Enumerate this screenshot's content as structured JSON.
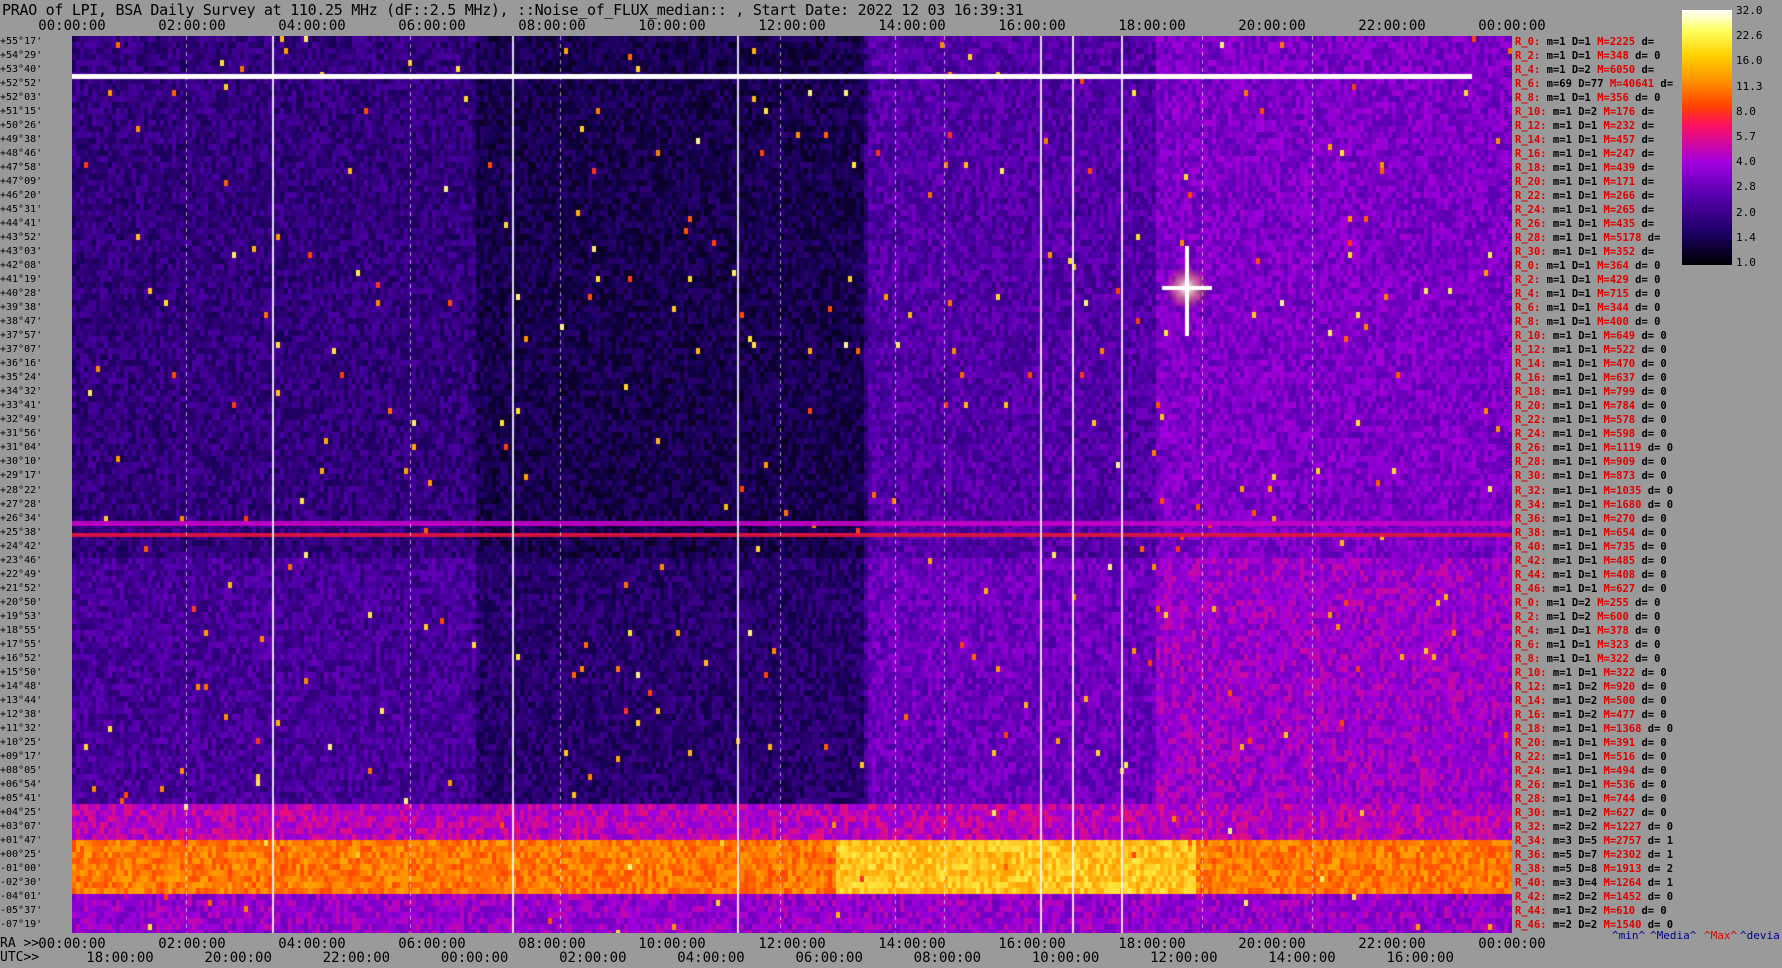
{
  "title": "PRAO of LPI, BSA Daily Survey at 110.25 MHz (dF::2.5 MHz), ::Noise_of_FLUX_median:: , Start Date: 2022 12 03 16:39:31",
  "colors": {
    "background": "#9a9a9a",
    "stat_label": "#e00000",
    "legend_max": "#e00000",
    "legend_other": "#00008b"
  },
  "chart_data": {
    "type": "heatmap",
    "title": "PRAO of LPI, BSA Daily Survey at 110.25 MHz (dF::2.5 MHz), ::Noise_of_FLUX_median:: , Start Date: 2022 12 03 16:39:31",
    "x_top_ticks": [
      "00:00:00",
      "02:00:00",
      "04:00:00",
      "06:00:00",
      "08:00:00",
      "10:00:00",
      "12:00:00",
      "14:00:00",
      "16:00:00",
      "18:00:00",
      "20:00:00",
      "22:00:00",
      "00:00:00"
    ],
    "x_bottom_ra_prefix": "RA >>",
    "x_bottom_ra_ticks": [
      "00:00:00",
      "02:00:00",
      "04:00:00",
      "06:00:00",
      "08:00:00",
      "10:00:00",
      "12:00:00",
      "14:00:00",
      "16:00:00",
      "18:00:00",
      "20:00:00",
      "22:00:00",
      "00:00:00"
    ],
    "x_bottom_utc_prefix": "UTC>>",
    "x_bottom_utc_ticks": [
      "18:00:00",
      "20:00:00",
      "22:00:00",
      "00:00:00",
      "02:00:00",
      "04:00:00",
      "06:00:00",
      "08:00:00",
      "10:00:00",
      "12:00:00",
      "14:00:00",
      "16:00:00"
    ],
    "colorbar_ticks": [
      "32.0",
      "22.6",
      "16.0",
      "11.3",
      "8.0",
      "5.7",
      "4.0",
      "2.8",
      "2.0",
      "1.4",
      "1.0"
    ],
    "declinations": [
      "+55°17'",
      "+54°29'",
      "+53°40'",
      "+52°52'",
      "+52°03'",
      "+51°15'",
      "+50°26'",
      "+49°38'",
      "+48°46'",
      "+47°58'",
      "+47°09'",
      "+46°20'",
      "+45°31'",
      "+44°41'",
      "+43°52'",
      "+43°03'",
      "+42°08'",
      "+41°19'",
      "+40°28'",
      "+39°38'",
      "+38°47'",
      "+37°57'",
      "+37°07'",
      "+36°16'",
      "+35°24'",
      "+34°32'",
      "+33°41'",
      "+32°49'",
      "+31°56'",
      "+31°04'",
      "+30°10'",
      "+29°17'",
      "+28°22'",
      "+27°28'",
      "+26°34'",
      "+25°38'",
      "+24°42'",
      "+23°46'",
      "+22°49'",
      "+21°52'",
      "+20°50'",
      "+19°53'",
      "+18°55'",
      "+17°55'",
      "+16°52'",
      "+15°50'",
      "+14°48'",
      "+13°44'",
      "+12°38'",
      "+11°32'",
      "+10°25'",
      "+09°17'",
      "+08°05'",
      "+06°54'",
      "+05°41'",
      "+04°25'",
      "+03°07'",
      "+01°47'",
      "+00°25'",
      "-01°00'",
      "-02°30'",
      "-04°01'",
      "-05°37'",
      "-07°19'"
    ],
    "stats": [
      {
        "id": "R_0:",
        "m": "1",
        "d": "1",
        "M": "2225",
        "dev": ""
      },
      {
        "id": "R_2:",
        "m": "1",
        "d": "1",
        "M": "348",
        "dev": "0"
      },
      {
        "id": "R_4:",
        "m": "1",
        "d": "2",
        "M": "6050",
        "dev": ""
      },
      {
        "id": "R_6:",
        "m": "69",
        "d": "77",
        "M": "40641",
        "dev": ""
      },
      {
        "id": "R_8:",
        "m": "1",
        "d": "1",
        "M": "356",
        "dev": "0"
      },
      {
        "id": "R_10:",
        "m": "1",
        "d": "2",
        "M": "176",
        "dev": ""
      },
      {
        "id": "R_12:",
        "m": "1",
        "d": "1",
        "M": "232",
        "dev": ""
      },
      {
        "id": "R_14:",
        "m": "1",
        "d": "1",
        "M": "457",
        "dev": ""
      },
      {
        "id": "R_16:",
        "m": "1",
        "d": "1",
        "M": "247",
        "dev": ""
      },
      {
        "id": "R_18:",
        "m": "1",
        "d": "1",
        "M": "439",
        "dev": ""
      },
      {
        "id": "R_20:",
        "m": "1",
        "d": "1",
        "M": "171",
        "dev": ""
      },
      {
        "id": "R_22:",
        "m": "1",
        "d": "1",
        "M": "266",
        "dev": ""
      },
      {
        "id": "R_24:",
        "m": "1",
        "d": "1",
        "M": "265",
        "dev": ""
      },
      {
        "id": "R_26:",
        "m": "1",
        "d": "1",
        "M": "435",
        "dev": ""
      },
      {
        "id": "R_28:",
        "m": "1",
        "d": "1",
        "M": "5178",
        "dev": ""
      },
      {
        "id": "R_30:",
        "m": "1",
        "d": "1",
        "M": "352",
        "dev": ""
      },
      {
        "id": "R_0:",
        "m": "1",
        "d": "1",
        "M": "364",
        "dev": "0"
      },
      {
        "id": "R_2:",
        "m": "1",
        "d": "1",
        "M": "429",
        "dev": "0"
      },
      {
        "id": "R_4:",
        "m": "1",
        "d": "1",
        "M": "715",
        "dev": "0"
      },
      {
        "id": "R_6:",
        "m": "1",
        "d": "1",
        "M": "344",
        "dev": "0"
      },
      {
        "id": "R_8:",
        "m": "1",
        "d": "1",
        "M": "400",
        "dev": "0"
      },
      {
        "id": "R_10:",
        "m": "1",
        "d": "1",
        "M": "649",
        "dev": "0"
      },
      {
        "id": "R_12:",
        "m": "1",
        "d": "1",
        "M": "522",
        "dev": "0"
      },
      {
        "id": "R_14:",
        "m": "1",
        "d": "1",
        "M": "470",
        "dev": "0"
      },
      {
        "id": "R_16:",
        "m": "1",
        "d": "1",
        "M": "637",
        "dev": "0"
      },
      {
        "id": "R_18:",
        "m": "1",
        "d": "1",
        "M": "799",
        "dev": "0"
      },
      {
        "id": "R_20:",
        "m": "1",
        "d": "1",
        "M": "784",
        "dev": "0"
      },
      {
        "id": "R_22:",
        "m": "1",
        "d": "1",
        "M": "578",
        "dev": "0"
      },
      {
        "id": "R_24:",
        "m": "1",
        "d": "1",
        "M": "598",
        "dev": "0"
      },
      {
        "id": "R_26:",
        "m": "1",
        "d": "1",
        "M": "1119",
        "dev": "0"
      },
      {
        "id": "R_28:",
        "m": "1",
        "d": "1",
        "M": "909",
        "dev": "0"
      },
      {
        "id": "R_30:",
        "m": "1",
        "d": "1",
        "M": "873",
        "dev": "0"
      },
      {
        "id": "R_32:",
        "m": "1",
        "d": "1",
        "M": "1035",
        "dev": "0"
      },
      {
        "id": "R_34:",
        "m": "1",
        "d": "1",
        "M": "1680",
        "dev": "0"
      },
      {
        "id": "R_36:",
        "m": "1",
        "d": "1",
        "M": "270",
        "dev": "0"
      },
      {
        "id": "R_38:",
        "m": "1",
        "d": "1",
        "M": "654",
        "dev": "0"
      },
      {
        "id": "R_40:",
        "m": "1",
        "d": "1",
        "M": "735",
        "dev": "0"
      },
      {
        "id": "R_42:",
        "m": "1",
        "d": "1",
        "M": "485",
        "dev": "0"
      },
      {
        "id": "R_44:",
        "m": "1",
        "d": "1",
        "M": "408",
        "dev": "0"
      },
      {
        "id": "R_46:",
        "m": "1",
        "d": "1",
        "M": "627",
        "dev": "0"
      },
      {
        "id": "R_0:",
        "m": "1",
        "d": "2",
        "M": "255",
        "dev": "0"
      },
      {
        "id": "R_2:",
        "m": "1",
        "d": "2",
        "M": "600",
        "dev": "0"
      },
      {
        "id": "R_4:",
        "m": "1",
        "d": "1",
        "M": "378",
        "dev": "0"
      },
      {
        "id": "R_6:",
        "m": "1",
        "d": "1",
        "M": "323",
        "dev": "0"
      },
      {
        "id": "R_8:",
        "m": "1",
        "d": "1",
        "M": "322",
        "dev": "0"
      },
      {
        "id": "R_10:",
        "m": "1",
        "d": "1",
        "M": "322",
        "dev": "0"
      },
      {
        "id": "R_12:",
        "m": "1",
        "d": "2",
        "M": "920",
        "dev": "0"
      },
      {
        "id": "R_14:",
        "m": "1",
        "d": "2",
        "M": "500",
        "dev": "0"
      },
      {
        "id": "R_16:",
        "m": "1",
        "d": "2",
        "M": "477",
        "dev": "0"
      },
      {
        "id": "R_18:",
        "m": "1",
        "d": "1",
        "M": "1368",
        "dev": "0"
      },
      {
        "id": "R_20:",
        "m": "1",
        "d": "1",
        "M": "391",
        "dev": "0"
      },
      {
        "id": "R_22:",
        "m": "1",
        "d": "1",
        "M": "516",
        "dev": "0"
      },
      {
        "id": "R_24:",
        "m": "1",
        "d": "1",
        "M": "494",
        "dev": "0"
      },
      {
        "id": "R_26:",
        "m": "1",
        "d": "1",
        "M": "536",
        "dev": "0"
      },
      {
        "id": "R_28:",
        "m": "1",
        "d": "1",
        "M": "744",
        "dev": "0"
      },
      {
        "id": "R_30:",
        "m": "1",
        "d": "2",
        "M": "627",
        "dev": "0"
      },
      {
        "id": "R_32:",
        "m": "2",
        "d": "2",
        "M": "1227",
        "dev": "0"
      },
      {
        "id": "R_34:",
        "m": "3",
        "d": "5",
        "M": "2757",
        "dev": "1"
      },
      {
        "id": "R_36:",
        "m": "5",
        "d": "7",
        "M": "2302",
        "dev": "1"
      },
      {
        "id": "R_38:",
        "m": "5",
        "d": "8",
        "M": "1913",
        "dev": "2"
      },
      {
        "id": "R_40:",
        "m": "3",
        "d": "4",
        "M": "1264",
        "dev": "1"
      },
      {
        "id": "R_42:",
        "m": "2",
        "d": "2",
        "M": "1452",
        "dev": "0"
      },
      {
        "id": "R_44:",
        "m": "1",
        "d": "2",
        "M": "610",
        "dev": "0"
      },
      {
        "id": "R_46:",
        "m": "2",
        "d": "2",
        "M": "1540",
        "dev": "0"
      }
    ],
    "legend": {
      "min": "^min^",
      "media": "^Media^",
      "max": "^Max^",
      "devia": "^devia"
    }
  }
}
